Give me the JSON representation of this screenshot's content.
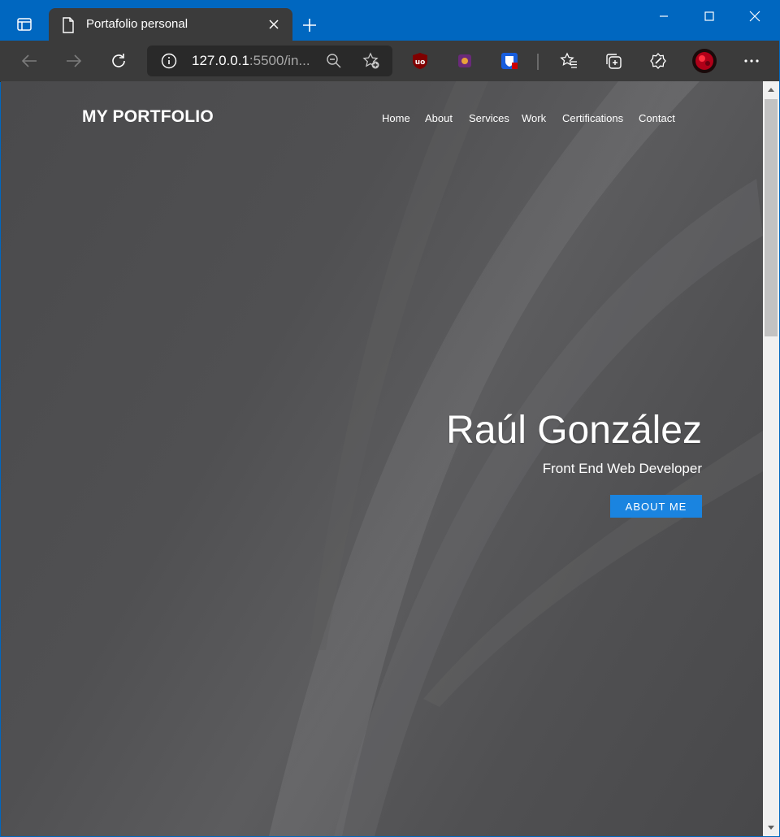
{
  "browser": {
    "tab": {
      "title": "Portafolio personal",
      "icon": "document-icon"
    },
    "address": {
      "host": "127.0.0.1",
      "rest": ":5500/in..."
    },
    "extensions": [
      "ublock-icon",
      "extension-purple-icon",
      "bitwarden-icon"
    ],
    "colors": {
      "titlebar": "#0067c0",
      "toolbar": "#3b3b3b"
    }
  },
  "site": {
    "brand": "MY PORTFOLIO",
    "nav": [
      "Home",
      "About",
      "Services",
      "Work",
      "Certifications",
      "Contact"
    ],
    "hero": {
      "name": "Raúl González",
      "subtitle": "Front End Web Developer",
      "button": "ABOUT ME"
    },
    "colors": {
      "accent": "#1a84e0",
      "background": "#505052"
    }
  }
}
